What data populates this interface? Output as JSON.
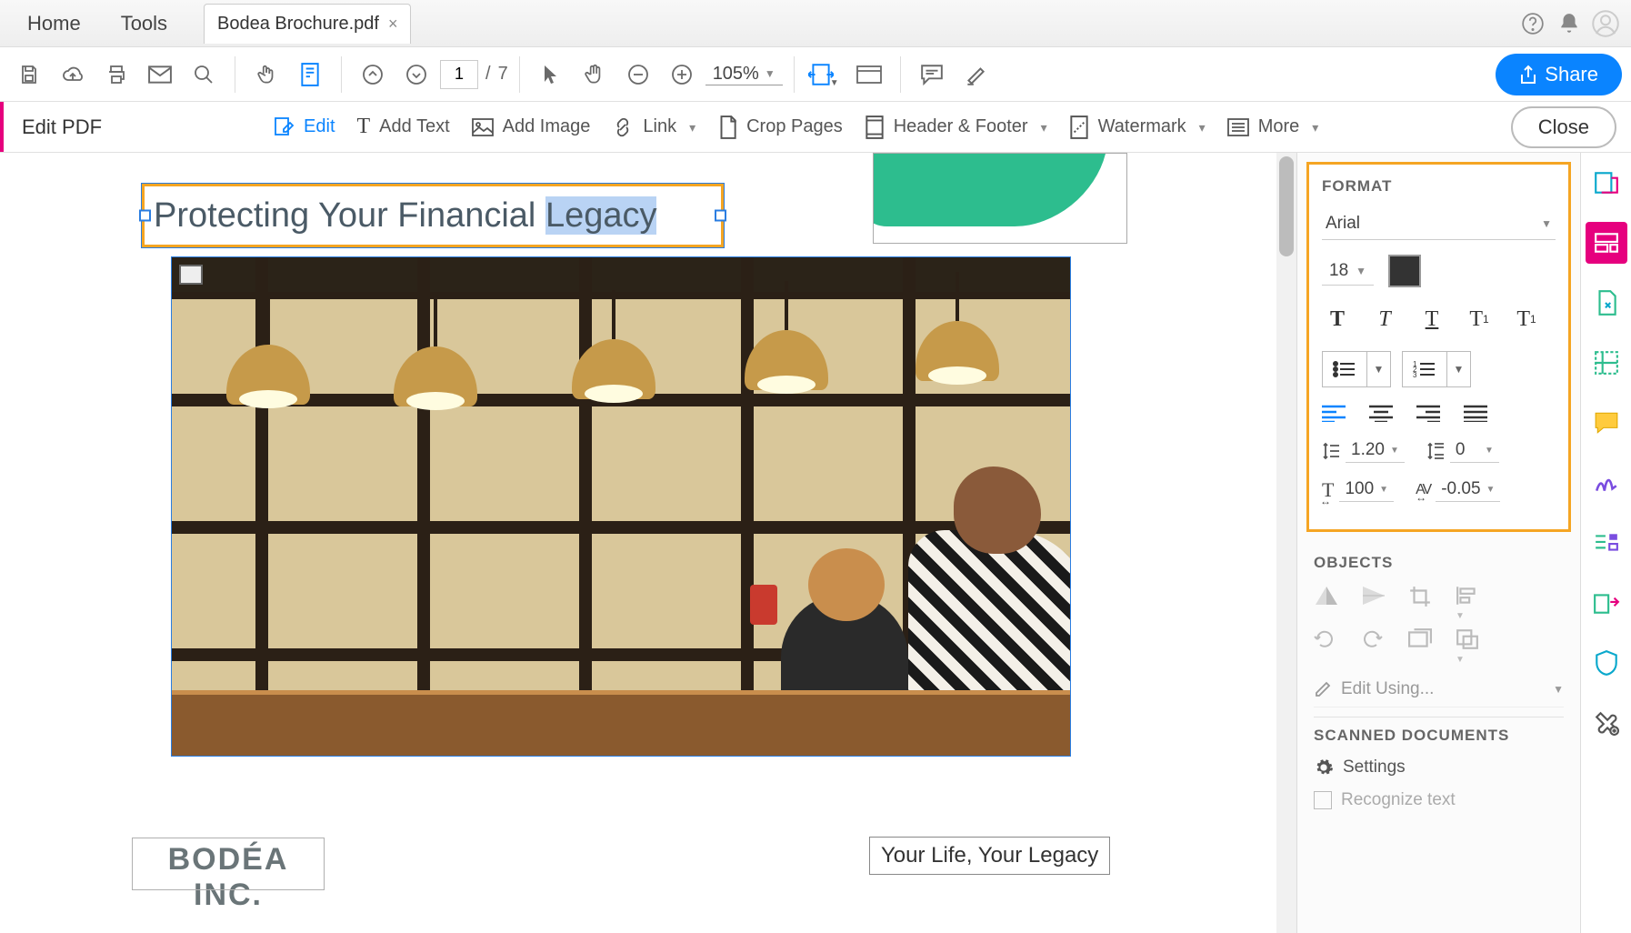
{
  "topbar": {
    "home": "Home",
    "tools": "Tools",
    "doc_title": "Bodea Brochure.pdf"
  },
  "toolbar": {
    "page_current": "1",
    "page_sep": "/",
    "page_total": "7",
    "zoom": "105%",
    "share": "Share"
  },
  "editbar": {
    "title": "Edit PDF",
    "edit": "Edit",
    "add_text": "Add Text",
    "add_image": "Add Image",
    "link": "Link",
    "crop": "Crop Pages",
    "header_footer": "Header & Footer",
    "watermark": "Watermark",
    "more": "More",
    "close": "Close"
  },
  "document": {
    "heading_pre": "Protecting Your Financial ",
    "heading_sel": "Legacy",
    "logo": "BODÉA INC.",
    "tagline": "Your Life, Your Legacy"
  },
  "format": {
    "section": "FORMAT",
    "font": "Arial",
    "size": "18",
    "color": "#333333",
    "line_spacing": "1.20",
    "para_spacing": "0",
    "hscale": "100",
    "tracking": "-0.05"
  },
  "objects": {
    "section": "OBJECTS",
    "edit_using": "Edit Using..."
  },
  "scanned": {
    "section": "SCANNED DOCUMENTS",
    "settings": "Settings",
    "recognize": "Recognize text"
  }
}
